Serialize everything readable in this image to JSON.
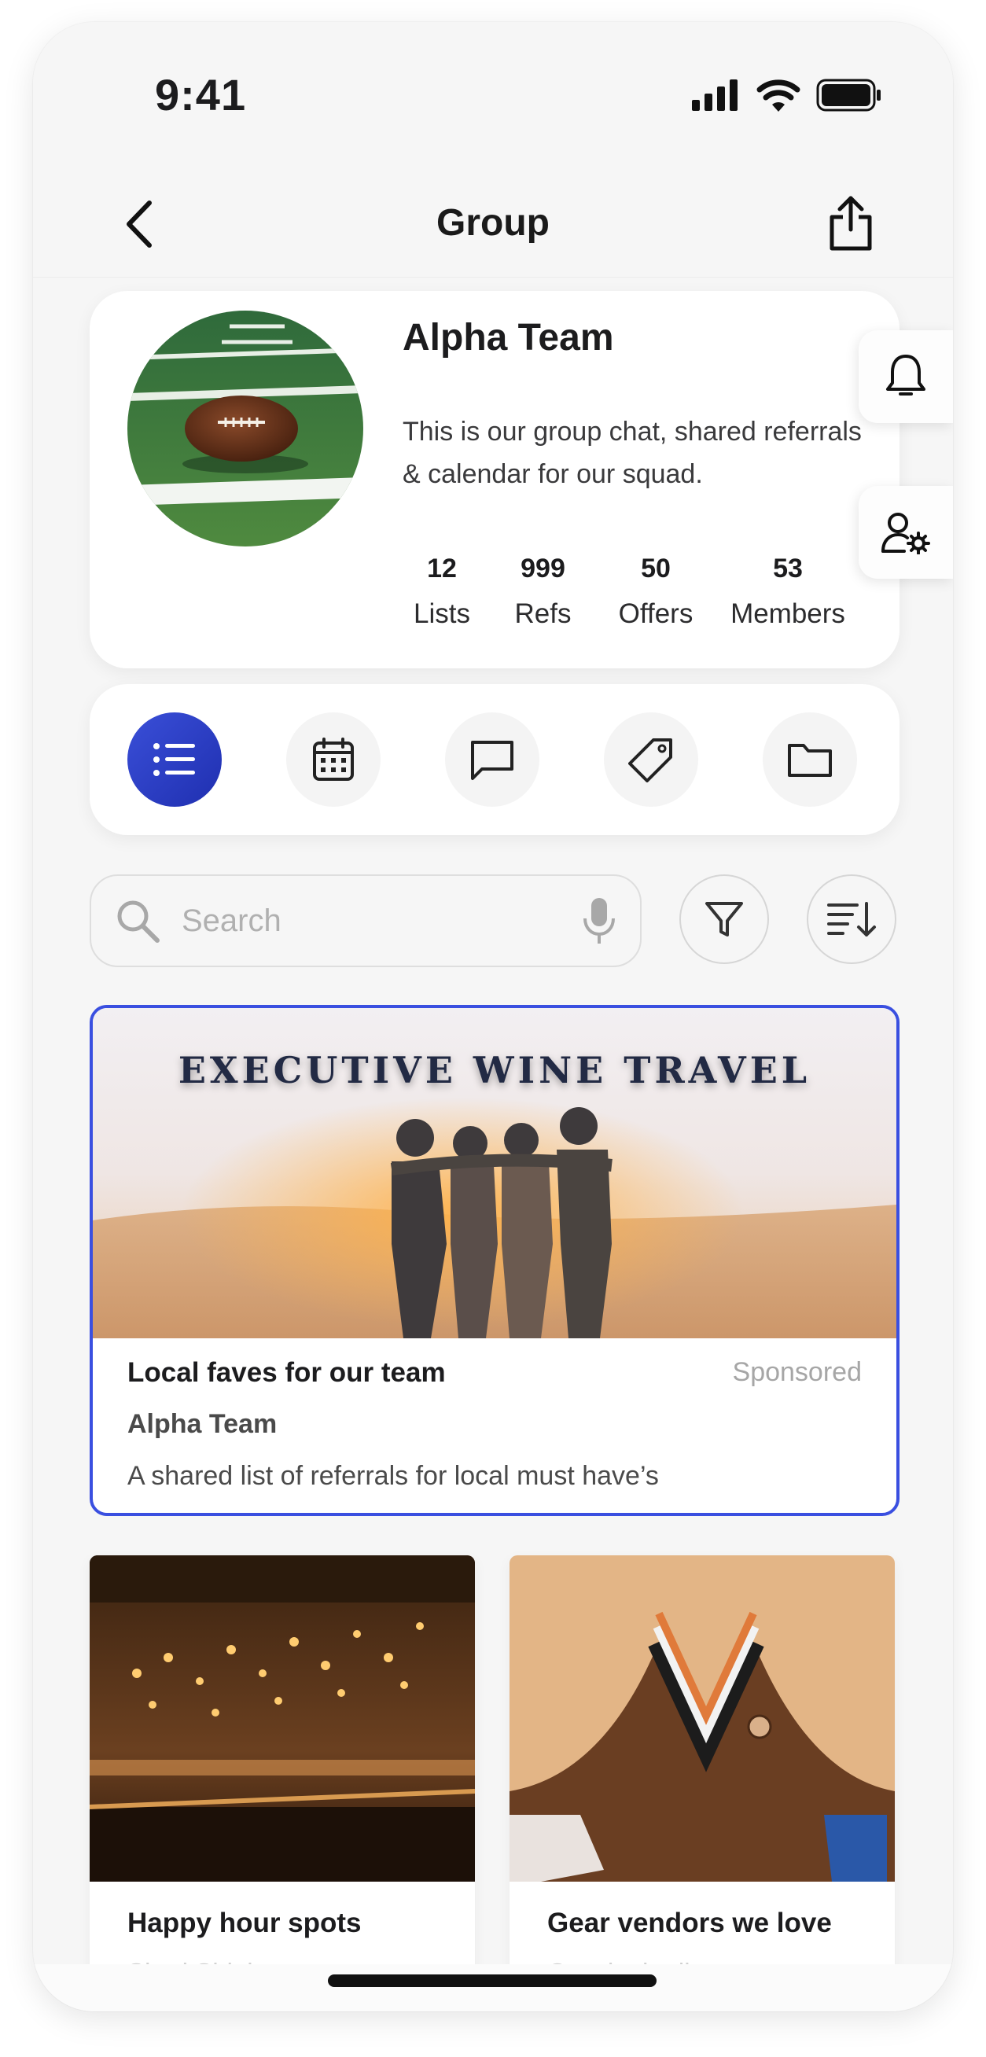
{
  "status_bar": {
    "time": "9:41",
    "icons": [
      "signal-icon",
      "wifi-icon",
      "battery-icon"
    ]
  },
  "nav": {
    "title": "Group",
    "back_icon": "chevron-left-icon",
    "share_icon": "share-icon"
  },
  "profile": {
    "name": "Alpha Team",
    "description": "This is our group chat, shared referrals & calendar for our squad.",
    "stats": [
      {
        "value": "12",
        "label": "Lists"
      },
      {
        "value": "999",
        "label": "Refs"
      },
      {
        "value": "50",
        "label": "Offers"
      },
      {
        "value": "53",
        "label": "Members"
      }
    ]
  },
  "side_actions": [
    "bell-icon",
    "user-settings-icon"
  ],
  "tabs": [
    {
      "name": "lists",
      "icon": "list-icon",
      "active": true
    },
    {
      "name": "calendar",
      "icon": "calendar-icon",
      "active": false
    },
    {
      "name": "chat",
      "icon": "chat-icon",
      "active": false
    },
    {
      "name": "offers",
      "icon": "tag-icon",
      "active": false
    },
    {
      "name": "files",
      "icon": "folder-icon",
      "active": false
    }
  ],
  "search": {
    "placeholder": "Search",
    "value": ""
  },
  "featured": {
    "banner": "EXECUTIVE WINE TRAVEL",
    "title": "Local faves for our team",
    "badge": "Sponsored",
    "author": "Alpha Team",
    "description": "A shared list of referrals for local must have’s"
  },
  "lists": [
    {
      "title": "Happy hour spots",
      "author": "Shari Shipley"
    },
    {
      "title": "Gear vendors we love",
      "author": "Cats in the line"
    }
  ],
  "colors": {
    "accent": "#2e3fd0",
    "card_border": "#3a4fe0",
    "muted": "#a6a6a6"
  }
}
